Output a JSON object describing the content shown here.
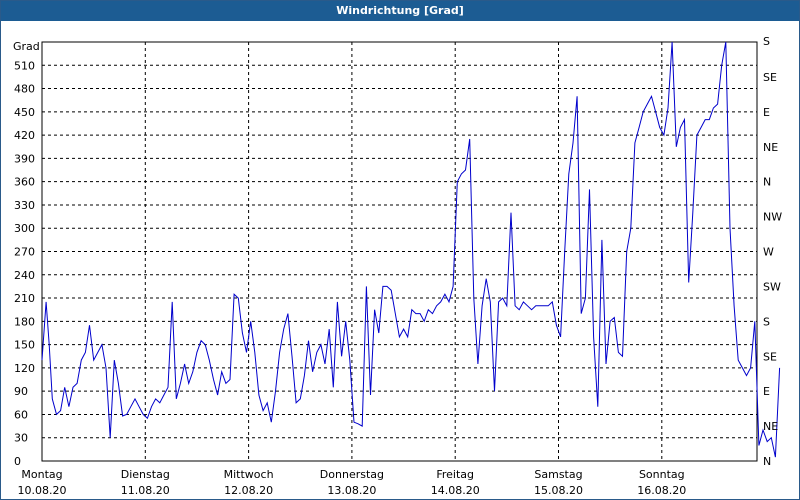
{
  "window": {
    "title": "Windrichtung [Grad]"
  },
  "colors": {
    "titlebar": "#1c5c93",
    "line": "#0000cc",
    "grid": "#000000",
    "background": "#ffffff"
  },
  "chart_data": {
    "type": "line",
    "title": "Windrichtung [Grad]",
    "ylabel": "Grad",
    "ylim": [
      0,
      540
    ],
    "xlim": [
      0,
      7
    ],
    "grid": true,
    "y_ticks": [
      0,
      30,
      60,
      90,
      120,
      150,
      180,
      210,
      240,
      270,
      300,
      330,
      360,
      390,
      420,
      450,
      480,
      510
    ],
    "y_ticks_right": [
      {
        "value": 0,
        "label": "N"
      },
      {
        "value": 45,
        "label": "NE"
      },
      {
        "value": 90,
        "label": "E"
      },
      {
        "value": 135,
        "label": "SE"
      },
      {
        "value": 180,
        "label": "S"
      },
      {
        "value": 225,
        "label": "SW"
      },
      {
        "value": 270,
        "label": "W"
      },
      {
        "value": 315,
        "label": "NW"
      },
      {
        "value": 360,
        "label": "N"
      },
      {
        "value": 405,
        "label": "NE"
      },
      {
        "value": 450,
        "label": "E"
      },
      {
        "value": 495,
        "label": "SE"
      },
      {
        "value": 540,
        "label": "S"
      }
    ],
    "x_ticks": [
      {
        "value": 0,
        "day": "Montag",
        "date": "10.08.20"
      },
      {
        "value": 1,
        "day": "Dienstag",
        "date": "11.08.20"
      },
      {
        "value": 2,
        "day": "Mittwoch",
        "date": "12.08.20"
      },
      {
        "value": 3,
        "day": "Donnerstag",
        "date": "13.08.20"
      },
      {
        "value": 4,
        "day": "Freitag",
        "date": "14.08.20"
      },
      {
        "value": 5,
        "day": "Samstag",
        "date": "15.08.20"
      },
      {
        "value": 6,
        "day": "Sonntag",
        "date": "16.08.20"
      }
    ],
    "series": [
      {
        "values": [
          [
            0.0,
            130
          ],
          [
            0.04,
            205
          ],
          [
            0.07,
            150
          ],
          [
            0.1,
            80
          ],
          [
            0.14,
            60
          ],
          [
            0.18,
            65
          ],
          [
            0.22,
            95
          ],
          [
            0.26,
            70
          ],
          [
            0.3,
            95
          ],
          [
            0.34,
            100
          ],
          [
            0.38,
            130
          ],
          [
            0.42,
            140
          ],
          [
            0.46,
            175
          ],
          [
            0.5,
            130
          ],
          [
            0.54,
            140
          ],
          [
            0.58,
            150
          ],
          [
            0.62,
            120
          ],
          [
            0.66,
            30
          ],
          [
            0.7,
            130
          ],
          [
            0.74,
            100
          ],
          [
            0.78,
            58
          ],
          [
            0.82,
            60
          ],
          [
            0.86,
            70
          ],
          [
            0.9,
            80
          ],
          [
            0.94,
            70
          ],
          [
            0.98,
            60
          ],
          [
            1.02,
            55
          ],
          [
            1.06,
            70
          ],
          [
            1.1,
            80
          ],
          [
            1.14,
            75
          ],
          [
            1.18,
            85
          ],
          [
            1.22,
            95
          ],
          [
            1.26,
            205
          ],
          [
            1.3,
            80
          ],
          [
            1.34,
            100
          ],
          [
            1.38,
            125
          ],
          [
            1.42,
            100
          ],
          [
            1.46,
            115
          ],
          [
            1.5,
            140
          ],
          [
            1.54,
            155
          ],
          [
            1.58,
            150
          ],
          [
            1.62,
            130
          ],
          [
            1.66,
            105
          ],
          [
            1.7,
            85
          ],
          [
            1.74,
            115
          ],
          [
            1.78,
            100
          ],
          [
            1.82,
            105
          ],
          [
            1.86,
            215
          ],
          [
            1.9,
            210
          ],
          [
            1.94,
            165
          ],
          [
            1.98,
            140
          ],
          [
            2.02,
            180
          ],
          [
            2.06,
            140
          ],
          [
            2.1,
            85
          ],
          [
            2.14,
            65
          ],
          [
            2.18,
            75
          ],
          [
            2.22,
            50
          ],
          [
            2.26,
            90
          ],
          [
            2.3,
            140
          ],
          [
            2.34,
            170
          ],
          [
            2.38,
            190
          ],
          [
            2.42,
            135
          ],
          [
            2.46,
            75
          ],
          [
            2.5,
            80
          ],
          [
            2.54,
            110
          ],
          [
            2.58,
            155
          ],
          [
            2.62,
            115
          ],
          [
            2.66,
            140
          ],
          [
            2.7,
            150
          ],
          [
            2.74,
            125
          ],
          [
            2.78,
            170
          ],
          [
            2.82,
            95
          ],
          [
            2.86,
            205
          ],
          [
            2.9,
            135
          ],
          [
            2.94,
            180
          ],
          [
            2.98,
            130
          ],
          [
            3.02,
            50
          ],
          [
            3.06,
            48
          ],
          [
            3.1,
            45
          ],
          [
            3.14,
            225
          ],
          [
            3.18,
            85
          ],
          [
            3.22,
            195
          ],
          [
            3.26,
            165
          ],
          [
            3.3,
            225
          ],
          [
            3.34,
            225
          ],
          [
            3.38,
            220
          ],
          [
            3.42,
            190
          ],
          [
            3.46,
            160
          ],
          [
            3.5,
            170
          ],
          [
            3.54,
            160
          ],
          [
            3.58,
            195
          ],
          [
            3.62,
            190
          ],
          [
            3.66,
            190
          ],
          [
            3.7,
            180
          ],
          [
            3.74,
            195
          ],
          [
            3.78,
            190
          ],
          [
            3.82,
            200
          ],
          [
            3.86,
            205
          ],
          [
            3.9,
            215
          ],
          [
            3.94,
            205
          ],
          [
            3.98,
            225
          ],
          [
            4.02,
            360
          ],
          [
            4.06,
            370
          ],
          [
            4.1,
            375
          ],
          [
            4.14,
            415
          ],
          [
            4.18,
            210
          ],
          [
            4.22,
            125
          ],
          [
            4.26,
            200
          ],
          [
            4.3,
            235
          ],
          [
            4.34,
            205
          ],
          [
            4.38,
            90
          ],
          [
            4.42,
            205
          ],
          [
            4.46,
            210
          ],
          [
            4.5,
            200
          ],
          [
            4.54,
            320
          ],
          [
            4.58,
            200
          ],
          [
            4.62,
            195
          ],
          [
            4.66,
            205
          ],
          [
            4.7,
            200
          ],
          [
            4.74,
            195
          ],
          [
            4.78,
            200
          ],
          [
            4.82,
            200
          ],
          [
            4.86,
            200
          ],
          [
            4.9,
            200
          ],
          [
            4.94,
            205
          ],
          [
            4.98,
            175
          ],
          [
            5.02,
            160
          ],
          [
            5.06,
            270
          ],
          [
            5.1,
            370
          ],
          [
            5.14,
            410
          ],
          [
            5.18,
            470
          ],
          [
            5.22,
            190
          ],
          [
            5.26,
            210
          ],
          [
            5.3,
            350
          ],
          [
            5.34,
            160
          ],
          [
            5.38,
            70
          ],
          [
            5.42,
            285
          ],
          [
            5.46,
            125
          ],
          [
            5.5,
            180
          ],
          [
            5.54,
            185
          ],
          [
            5.58,
            140
          ],
          [
            5.62,
            135
          ],
          [
            5.66,
            270
          ],
          [
            5.7,
            300
          ],
          [
            5.74,
            410
          ],
          [
            5.78,
            430
          ],
          [
            5.82,
            450
          ],
          [
            5.86,
            460
          ],
          [
            5.9,
            470
          ],
          [
            5.94,
            450
          ],
          [
            5.98,
            430
          ],
          [
            6.02,
            420
          ],
          [
            6.06,
            455
          ],
          [
            6.1,
            540
          ],
          [
            6.14,
            405
          ],
          [
            6.18,
            430
          ],
          [
            6.22,
            440
          ],
          [
            6.26,
            230
          ],
          [
            6.3,
            320
          ],
          [
            6.34,
            420
          ],
          [
            6.38,
            430
          ],
          [
            6.42,
            440
          ],
          [
            6.46,
            440
          ],
          [
            6.5,
            455
          ],
          [
            6.54,
            460
          ],
          [
            6.58,
            510
          ],
          [
            6.62,
            540
          ],
          [
            6.66,
            300
          ],
          [
            6.7,
            200
          ],
          [
            6.74,
            130
          ],
          [
            6.78,
            120
          ],
          [
            6.82,
            110
          ],
          [
            6.86,
            120
          ],
          [
            6.9,
            180
          ],
          [
            6.94,
            20
          ],
          [
            6.98,
            40
          ],
          [
            7.02,
            25
          ],
          [
            7.06,
            30
          ],
          [
            7.1,
            5
          ],
          [
            7.14,
            120
          ]
        ]
      }
    ]
  }
}
